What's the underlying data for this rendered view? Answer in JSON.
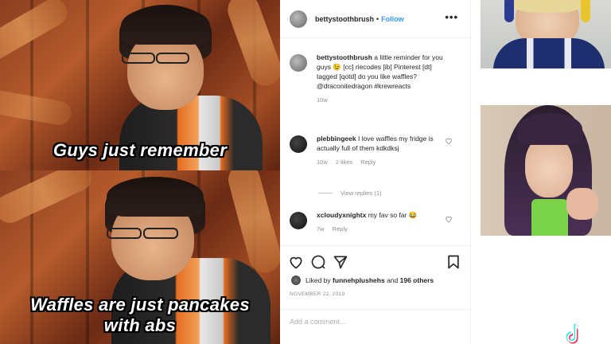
{
  "meme": {
    "caption_top": "Guys just remember",
    "caption_bottom_line1": "Waffles are just pancakes",
    "caption_bottom_line2": "with abs"
  },
  "post": {
    "username": "bettystoothbrush",
    "dot": "•",
    "follow_label": "Follow",
    "more_label": "•••",
    "caption": {
      "username": "bettystoothbrush",
      "text": "a little reminder for you guys 😉 [cc] riecodes [ib] Pinterest [dt] tagged [qotd] do you like waffles? @draconitedragon #krewreacts",
      "time": "10w"
    },
    "comments": [
      {
        "username": "plebbingeek",
        "text": "I love waffles my fridge is actually full of them kdkdksj",
        "time": "10w",
        "likes": "2 likes",
        "reply": "Reply",
        "view_replies": "View replies (1)"
      },
      {
        "username": "xcloudyxnightx",
        "text": "my fav so far 😂",
        "time": "7w",
        "reply": "Reply"
      }
    ],
    "likes_prefix": "Liked by",
    "likes_user": "funnehplushehs",
    "likes_and": "and",
    "likes_others": "196 others",
    "date": "NOVEMBER 22, 2019",
    "add_comment_placeholder": "Add a comment..."
  },
  "colors": {
    "accent_blue": "#3897f0",
    "meta_gray": "#8e8e8e",
    "text": "#262626"
  },
  "icons": [
    "more-icon",
    "heart-icon",
    "comment-icon",
    "share-icon",
    "bookmark-icon",
    "tiktok-logo-icon"
  ]
}
